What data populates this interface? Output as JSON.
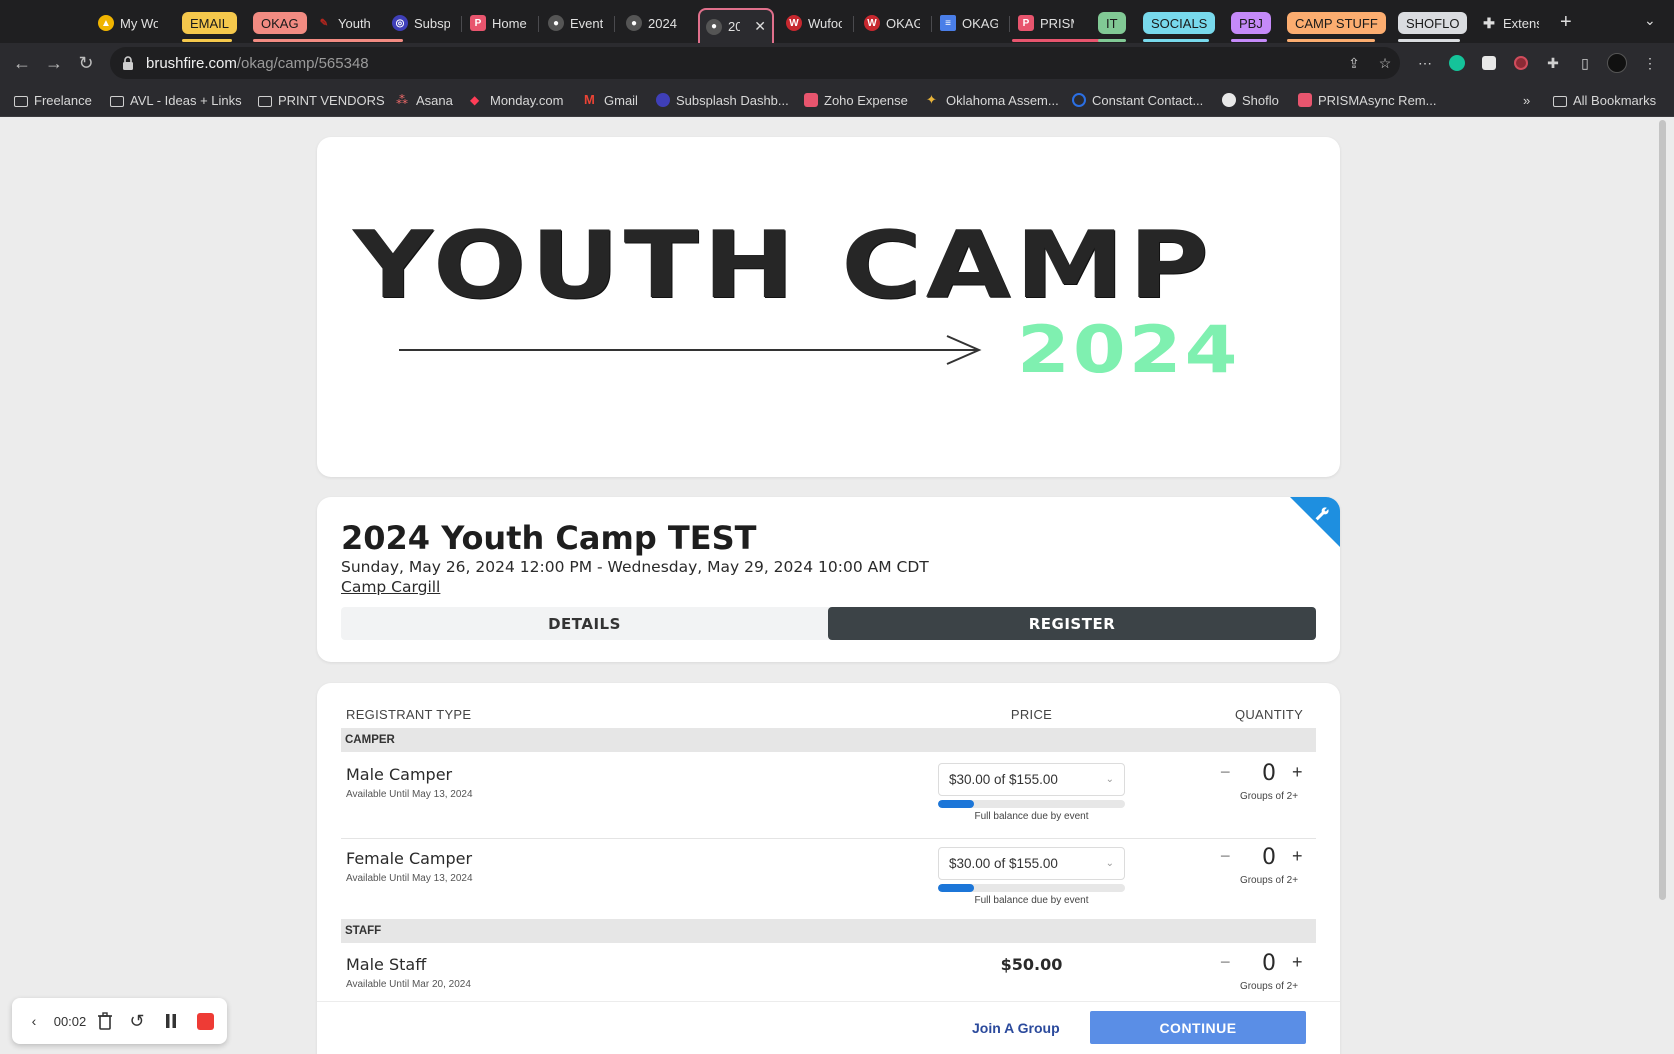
{
  "tabs": [
    {
      "label": "My Wo",
      "icon": "google-drive-icon",
      "color": "#f0b400"
    },
    {
      "group": "EMAIL",
      "color": "#f5c84c"
    },
    {
      "group": "OKAG",
      "color": "#f28b82"
    },
    {
      "label": "Youth",
      "icon": "red-app-icon",
      "color": "#b3261e"
    },
    {
      "label": "Subsp",
      "icon": "subsplash-icon",
      "color": "#6f6fe6"
    },
    {
      "label": "Home",
      "icon": "prisma-icon",
      "color": "#e8556e"
    },
    {
      "label": "Event",
      "icon": "brushfire-icon",
      "color": "#555555"
    },
    {
      "label": "2024",
      "icon": "brushfire-icon",
      "color": "#555555"
    },
    {
      "label": "20",
      "icon": "brushfire-icon",
      "color": "#555555",
      "active": true
    },
    {
      "label": "Wufoo",
      "icon": "wufoo-icon",
      "color": "#c7282f"
    },
    {
      "label": "OKAG",
      "icon": "wufoo-icon",
      "color": "#c7282f"
    },
    {
      "label": "OKAG",
      "icon": "google-docs-icon",
      "color": "#4a7ee8"
    },
    {
      "label": "PRISM",
      "icon": "prisma-icon",
      "color": "#e8556e"
    },
    {
      "group": "IT",
      "color": "#81c995"
    },
    {
      "group": "SOCIALS",
      "color": "#78d9ec"
    },
    {
      "group": "PBJ",
      "color": "#c58af9"
    },
    {
      "group": "CAMP STUFF",
      "color": "#fcad70"
    },
    {
      "group": "SHOFLO",
      "color": "#dadce0"
    },
    {
      "label": "Extens",
      "icon": "puzzle-icon",
      "color": "#dddddd"
    }
  ],
  "address_bar": {
    "host": "brushfire.com",
    "path": "/okag/camp/565348"
  },
  "bookmarks": [
    "Freelance",
    "AVL - Ideas + Links",
    "PRINT VENDORS",
    "Asana",
    "Monday.com",
    "Gmail",
    "Subsplash Dashb...",
    "Zoho Expense",
    "Oklahoma Assem...",
    "Constant Contact...",
    "Shoflo",
    "PRISMAsync Rem..."
  ],
  "bookmarks_more": "»",
  "all_bookmarks": "All Bookmarks",
  "banner": {
    "line1": "YOUTH CAMP",
    "line2": "2024"
  },
  "event": {
    "title": "2024 Youth Camp TEST",
    "dates": "Sunday, May 26, 2024 12:00 PM - Wednesday, May 29, 2024 10:00 AM CDT",
    "venue": "Camp Cargill",
    "tab_details": "DETAILS",
    "tab_register": "REGISTER"
  },
  "registration": {
    "col_type": "REGISTRANT TYPE",
    "col_price": "PRICE",
    "col_qty": "QUANTITY",
    "sections": [
      {
        "name": "CAMPER",
        "rows": [
          {
            "name": "Male Camper",
            "avail": "Available Until May 13, 2024",
            "price_select": "$30.00 of $155.00",
            "progress": 0.19,
            "note": "Full balance due by event",
            "qty": "0",
            "group": "Groups of 2+"
          },
          {
            "name": "Female Camper",
            "avail": "Available Until May 13, 2024",
            "price_select": "$30.00 of $155.00",
            "progress": 0.19,
            "note": "Full balance due by event",
            "qty": "0",
            "group": "Groups of 2+"
          }
        ]
      },
      {
        "name": "STAFF",
        "rows": [
          {
            "name": "Male Staff",
            "avail": "Available Until Mar 20, 2024",
            "price": "$50.00",
            "qty": "0",
            "group": "Groups of 2+"
          }
        ]
      }
    ],
    "join_group": "Join A Group",
    "continue": "CONTINUE"
  },
  "recorder": {
    "time": "00:02"
  }
}
